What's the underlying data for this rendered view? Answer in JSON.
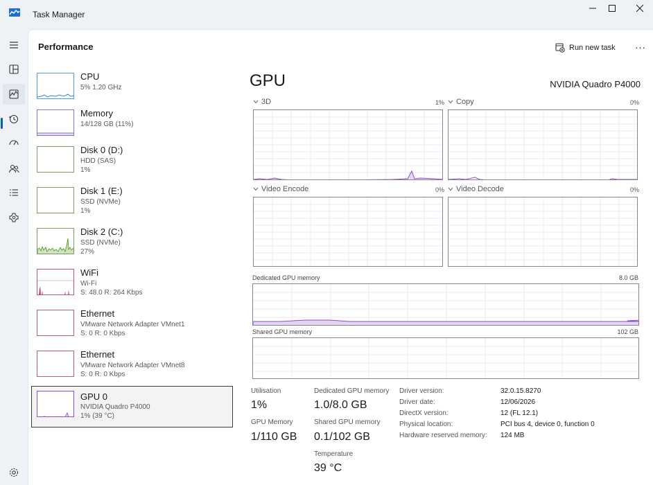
{
  "window": {
    "title": "Task Manager",
    "controls": [
      "minimize",
      "maximize",
      "close"
    ]
  },
  "nav": {
    "items": [
      {
        "icon": "hamburger-icon"
      },
      {
        "icon": "processes-icon"
      },
      {
        "icon": "performance-icon",
        "active": true
      },
      {
        "icon": "app-history-icon"
      },
      {
        "icon": "startup-apps-icon"
      },
      {
        "icon": "users-icon"
      },
      {
        "icon": "details-icon"
      },
      {
        "icon": "services-icon"
      }
    ],
    "settings_icon": "settings-icon"
  },
  "header": {
    "title": "Performance",
    "run_task_label": "Run new task",
    "more_label": "..."
  },
  "devices": [
    {
      "name": "CPU",
      "line1": "5% 1.20 GHz",
      "line2": ""
    },
    {
      "name": "Memory",
      "line1": "14/128 GB (11%)",
      "line2": ""
    },
    {
      "name": "Disk 0 (D:)",
      "line1": "HDD (SAS)",
      "line2": "1%"
    },
    {
      "name": "Disk 1 (E:)",
      "line1": "SSD (NVMe)",
      "line2": "1%"
    },
    {
      "name": "Disk 2 (C:)",
      "line1": "SSD (NVMe)",
      "line2": "27%"
    },
    {
      "name": "WiFi",
      "line1": "Wi-Fi",
      "line2": "S: 48.0  R: 264 Kbps"
    },
    {
      "name": "Ethernet",
      "line1": "VMware Network Adapter VMnet1",
      "line2": "S: 0  R: 0 Kbps"
    },
    {
      "name": "Ethernet",
      "line1": "VMware Network Adapter VMnet8",
      "line2": "S: 0  R: 0 Kbps"
    },
    {
      "name": "GPU 0",
      "line1": "NVIDIA Quadro P4000",
      "line2": "1% (39 °C)",
      "selected": true
    }
  ],
  "gpu": {
    "title": "GPU",
    "model": "NVIDIA Quadro P4000",
    "engines": [
      {
        "label": "3D",
        "pct": "1%"
      },
      {
        "label": "Copy",
        "pct": "0%"
      },
      {
        "label": "Video Encode",
        "pct": "0%"
      },
      {
        "label": "Video Decode",
        "pct": "0%"
      }
    ],
    "dedicated_memory": {
      "label": "Dedicated GPU memory",
      "max": "8.0 GB"
    },
    "shared_memory": {
      "label": "Shared GPU memory",
      "max": "102 GB"
    },
    "stats": {
      "utilisation_label": "Utilisation",
      "utilisation_value": "1%",
      "dedicated_label": "Dedicated GPU memory",
      "dedicated_value": "1.0/8.0 GB",
      "gpu_memory_label": "GPU Memory",
      "gpu_memory_value": "1/110 GB",
      "shared_label": "Shared GPU memory",
      "shared_value": "0.1/102 GB",
      "temperature_label": "Temperature",
      "temperature_value": "39 °C"
    },
    "info": [
      {
        "key": "Driver version:",
        "value": "32.0.15.8270"
      },
      {
        "key": "Driver date:",
        "value": "12/06/2026"
      },
      {
        "key": "DirectX version:",
        "value": "12 (FL 12.1)"
      },
      {
        "key": "Physical location:",
        "value": "PCI bus 4, device 0, function 0"
      },
      {
        "key": "Hardware reserved memory:",
        "value": "124 MB"
      }
    ]
  },
  "colors": {
    "accent": "#0a5bc4",
    "cpu_line": "#1a8fc9",
    "memory_line": "#8b6fbf",
    "disk_line": "#4d8f1a",
    "network_line": "#b83b5e",
    "gpu_line": "#8b4fc7"
  }
}
